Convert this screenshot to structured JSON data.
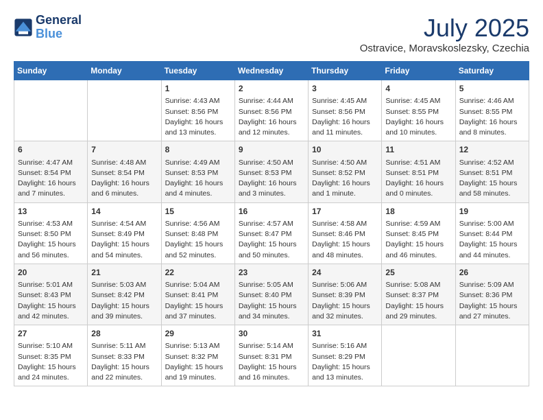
{
  "header": {
    "logo_line1": "General",
    "logo_line2": "Blue",
    "month": "July 2025",
    "location": "Ostravice, Moravskoslezsky, Czechia"
  },
  "days_of_week": [
    "Sunday",
    "Monday",
    "Tuesday",
    "Wednesday",
    "Thursday",
    "Friday",
    "Saturday"
  ],
  "weeks": [
    [
      {
        "day": "",
        "sunrise": "",
        "sunset": "",
        "daylight": ""
      },
      {
        "day": "",
        "sunrise": "",
        "sunset": "",
        "daylight": ""
      },
      {
        "day": "1",
        "sunrise": "Sunrise: 4:43 AM",
        "sunset": "Sunset: 8:56 PM",
        "daylight": "Daylight: 16 hours and 13 minutes."
      },
      {
        "day": "2",
        "sunrise": "Sunrise: 4:44 AM",
        "sunset": "Sunset: 8:56 PM",
        "daylight": "Daylight: 16 hours and 12 minutes."
      },
      {
        "day": "3",
        "sunrise": "Sunrise: 4:45 AM",
        "sunset": "Sunset: 8:56 PM",
        "daylight": "Daylight: 16 hours and 11 minutes."
      },
      {
        "day": "4",
        "sunrise": "Sunrise: 4:45 AM",
        "sunset": "Sunset: 8:55 PM",
        "daylight": "Daylight: 16 hours and 10 minutes."
      },
      {
        "day": "5",
        "sunrise": "Sunrise: 4:46 AM",
        "sunset": "Sunset: 8:55 PM",
        "daylight": "Daylight: 16 hours and 8 minutes."
      }
    ],
    [
      {
        "day": "6",
        "sunrise": "Sunrise: 4:47 AM",
        "sunset": "Sunset: 8:54 PM",
        "daylight": "Daylight: 16 hours and 7 minutes."
      },
      {
        "day": "7",
        "sunrise": "Sunrise: 4:48 AM",
        "sunset": "Sunset: 8:54 PM",
        "daylight": "Daylight: 16 hours and 6 minutes."
      },
      {
        "day": "8",
        "sunrise": "Sunrise: 4:49 AM",
        "sunset": "Sunset: 8:53 PM",
        "daylight": "Daylight: 16 hours and 4 minutes."
      },
      {
        "day": "9",
        "sunrise": "Sunrise: 4:50 AM",
        "sunset": "Sunset: 8:53 PM",
        "daylight": "Daylight: 16 hours and 3 minutes."
      },
      {
        "day": "10",
        "sunrise": "Sunrise: 4:50 AM",
        "sunset": "Sunset: 8:52 PM",
        "daylight": "Daylight: 16 hours and 1 minute."
      },
      {
        "day": "11",
        "sunrise": "Sunrise: 4:51 AM",
        "sunset": "Sunset: 8:51 PM",
        "daylight": "Daylight: 16 hours and 0 minutes."
      },
      {
        "day": "12",
        "sunrise": "Sunrise: 4:52 AM",
        "sunset": "Sunset: 8:51 PM",
        "daylight": "Daylight: 15 hours and 58 minutes."
      }
    ],
    [
      {
        "day": "13",
        "sunrise": "Sunrise: 4:53 AM",
        "sunset": "Sunset: 8:50 PM",
        "daylight": "Daylight: 15 hours and 56 minutes."
      },
      {
        "day": "14",
        "sunrise": "Sunrise: 4:54 AM",
        "sunset": "Sunset: 8:49 PM",
        "daylight": "Daylight: 15 hours and 54 minutes."
      },
      {
        "day": "15",
        "sunrise": "Sunrise: 4:56 AM",
        "sunset": "Sunset: 8:48 PM",
        "daylight": "Daylight: 15 hours and 52 minutes."
      },
      {
        "day": "16",
        "sunrise": "Sunrise: 4:57 AM",
        "sunset": "Sunset: 8:47 PM",
        "daylight": "Daylight: 15 hours and 50 minutes."
      },
      {
        "day": "17",
        "sunrise": "Sunrise: 4:58 AM",
        "sunset": "Sunset: 8:46 PM",
        "daylight": "Daylight: 15 hours and 48 minutes."
      },
      {
        "day": "18",
        "sunrise": "Sunrise: 4:59 AM",
        "sunset": "Sunset: 8:45 PM",
        "daylight": "Daylight: 15 hours and 46 minutes."
      },
      {
        "day": "19",
        "sunrise": "Sunrise: 5:00 AM",
        "sunset": "Sunset: 8:44 PM",
        "daylight": "Daylight: 15 hours and 44 minutes."
      }
    ],
    [
      {
        "day": "20",
        "sunrise": "Sunrise: 5:01 AM",
        "sunset": "Sunset: 8:43 PM",
        "daylight": "Daylight: 15 hours and 42 minutes."
      },
      {
        "day": "21",
        "sunrise": "Sunrise: 5:03 AM",
        "sunset": "Sunset: 8:42 PM",
        "daylight": "Daylight: 15 hours and 39 minutes."
      },
      {
        "day": "22",
        "sunrise": "Sunrise: 5:04 AM",
        "sunset": "Sunset: 8:41 PM",
        "daylight": "Daylight: 15 hours and 37 minutes."
      },
      {
        "day": "23",
        "sunrise": "Sunrise: 5:05 AM",
        "sunset": "Sunset: 8:40 PM",
        "daylight": "Daylight: 15 hours and 34 minutes."
      },
      {
        "day": "24",
        "sunrise": "Sunrise: 5:06 AM",
        "sunset": "Sunset: 8:39 PM",
        "daylight": "Daylight: 15 hours and 32 minutes."
      },
      {
        "day": "25",
        "sunrise": "Sunrise: 5:08 AM",
        "sunset": "Sunset: 8:37 PM",
        "daylight": "Daylight: 15 hours and 29 minutes."
      },
      {
        "day": "26",
        "sunrise": "Sunrise: 5:09 AM",
        "sunset": "Sunset: 8:36 PM",
        "daylight": "Daylight: 15 hours and 27 minutes."
      }
    ],
    [
      {
        "day": "27",
        "sunrise": "Sunrise: 5:10 AM",
        "sunset": "Sunset: 8:35 PM",
        "daylight": "Daylight: 15 hours and 24 minutes."
      },
      {
        "day": "28",
        "sunrise": "Sunrise: 5:11 AM",
        "sunset": "Sunset: 8:33 PM",
        "daylight": "Daylight: 15 hours and 22 minutes."
      },
      {
        "day": "29",
        "sunrise": "Sunrise: 5:13 AM",
        "sunset": "Sunset: 8:32 PM",
        "daylight": "Daylight: 15 hours and 19 minutes."
      },
      {
        "day": "30",
        "sunrise": "Sunrise: 5:14 AM",
        "sunset": "Sunset: 8:31 PM",
        "daylight": "Daylight: 15 hours and 16 minutes."
      },
      {
        "day": "31",
        "sunrise": "Sunrise: 5:16 AM",
        "sunset": "Sunset: 8:29 PM",
        "daylight": "Daylight: 15 hours and 13 minutes."
      },
      {
        "day": "",
        "sunrise": "",
        "sunset": "",
        "daylight": ""
      },
      {
        "day": "",
        "sunrise": "",
        "sunset": "",
        "daylight": ""
      }
    ]
  ]
}
